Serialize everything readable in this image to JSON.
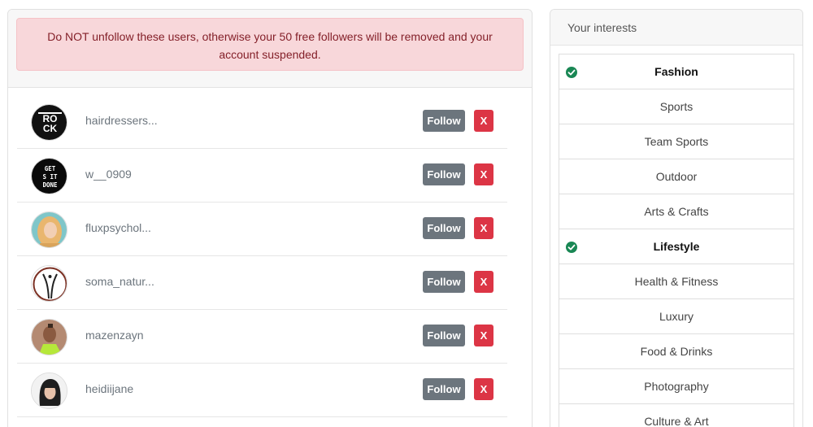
{
  "warning": "Do NOT unfollow these users, otherwise your 50 free followers will be removed and your account suspended.",
  "users": [
    {
      "username": "hairdressers...",
      "follow_label": "Follow",
      "remove_label": "X",
      "avatar": "rock-logo-avatar"
    },
    {
      "username": "w__0909",
      "follow_label": "Follow",
      "remove_label": "X",
      "avatar": "get-shit-done-avatar"
    },
    {
      "username": "fluxpsychol...",
      "follow_label": "Follow",
      "remove_label": "X",
      "avatar": "blonde-woman-avatar"
    },
    {
      "username": "soma_natur...",
      "follow_label": "Follow",
      "remove_label": "X",
      "avatar": "figure-logo-avatar"
    },
    {
      "username": "mazenzayn",
      "follow_label": "Follow",
      "remove_label": "X",
      "avatar": "man-neon-avatar"
    },
    {
      "username": "heidiijane",
      "follow_label": "Follow",
      "remove_label": "X",
      "avatar": "dark-hair-woman-avatar"
    }
  ],
  "interests_panel": {
    "title": "Your interests",
    "items": [
      {
        "label": "Fashion",
        "selected": true
      },
      {
        "label": "Sports",
        "selected": false
      },
      {
        "label": "Team Sports",
        "selected": false
      },
      {
        "label": "Outdoor",
        "selected": false
      },
      {
        "label": "Arts & Crafts",
        "selected": false
      },
      {
        "label": "Lifestyle",
        "selected": true
      },
      {
        "label": "Health & Fitness",
        "selected": false
      },
      {
        "label": "Luxury",
        "selected": false
      },
      {
        "label": "Food & Drinks",
        "selected": false
      },
      {
        "label": "Photography",
        "selected": false
      },
      {
        "label": "Culture & Art",
        "selected": false
      }
    ]
  },
  "colors": {
    "alert_bg": "#f8d7da",
    "alert_text": "#842029",
    "follow": "#6c757d",
    "remove": "#dc3545",
    "check": "#198754"
  }
}
